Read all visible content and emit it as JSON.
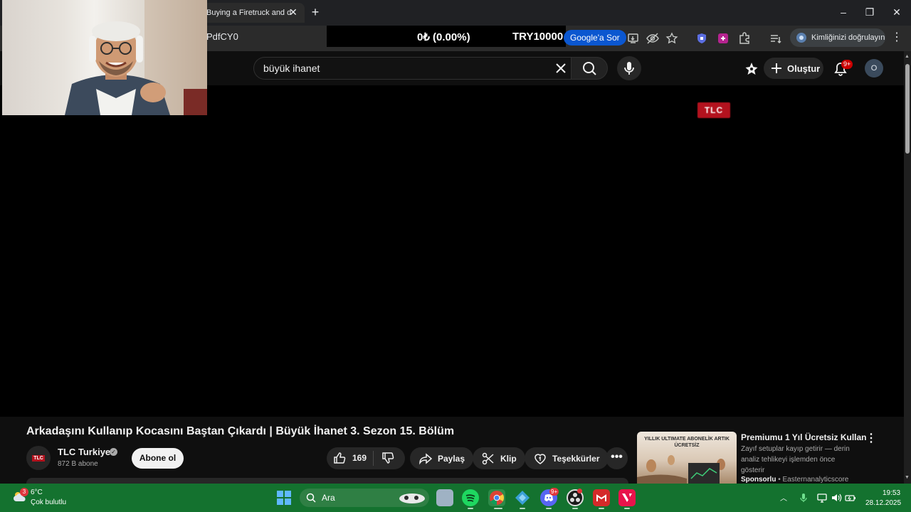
{
  "browser": {
    "tab_title": "Buying a Firetruck and d",
    "url_fragment": "PdfCY0",
    "ticker_change": "0₺ (0.00%)",
    "ticker_value": "TRY10000",
    "google_sor": "Google'a Sor",
    "profile_label": "Kimliğinizi doğrulayın"
  },
  "youtube": {
    "search_query": "büyük ihanet",
    "create_label": "Oluştur",
    "notification_count": "9+",
    "avatar_letter": "O",
    "player_logo": "TLC",
    "video_title": "Arkadaşını Kullanıp Kocasını Baştan Çıkardı | Büyük İhanet 3. Sezon 15. Bölüm",
    "channel": {
      "avatar_text": "TLC",
      "name": "TLC Turkiye",
      "subscribers": "872 B abone",
      "subscribe_label": "Abone ol"
    },
    "actions": {
      "like_count": "169",
      "share_label": "Paylaş",
      "clip_label": "Klip",
      "thanks_label": "Teşekkürler",
      "more_label": "•••"
    },
    "ad": {
      "thumb_text": "YILLIK ULTIMATE ABONELİK ARTIK ÜCRETSİZ",
      "title": "Premiumu 1 Yıl Ücretsiz Kullan",
      "description": "Zayıf setuplar kayıp getirir — derin analiz tehlikeyi işlemden önce gösterir",
      "sponsor_label": "Sponsorlu",
      "sponsor_sep": " • ",
      "advertiser": "Easternanalyticscore"
    }
  },
  "taskbar": {
    "weather_badge": "3",
    "temperature": "6°C",
    "weather_desc": "Çok bulutlu",
    "search_label": "Ara",
    "discord_badge": "9+",
    "time": "19:53",
    "date": "28.12.2025"
  },
  "colors": {
    "yt_background": "#0f0f0f",
    "taskbar_green": "#14722f",
    "brand_red": "#cc0000",
    "google_blue": "#0b57d0"
  }
}
